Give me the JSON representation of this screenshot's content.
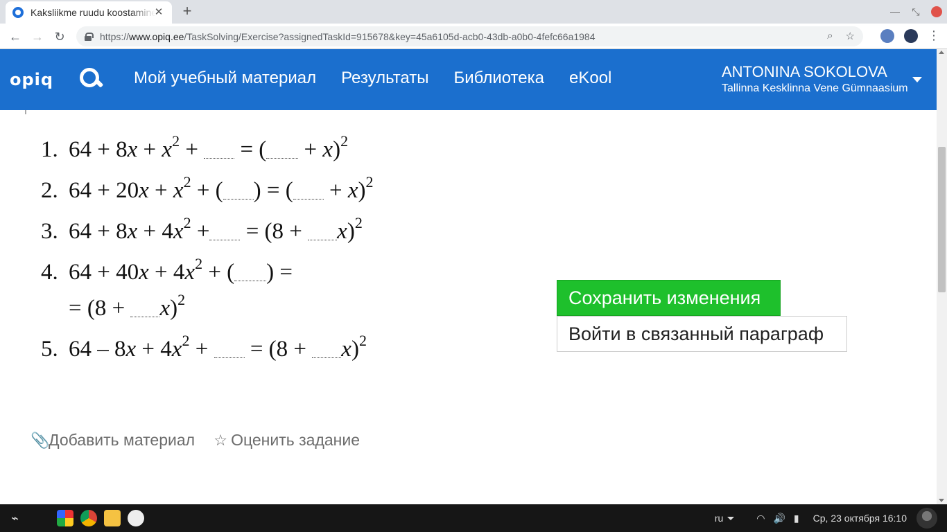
{
  "browser": {
    "tab_title": "Kaksliikme ruudu koostamine",
    "url_scheme": "https://",
    "url_host": "www.opiq.ee",
    "url_path": "/TaskSolving/Exercise?assignedTaskId=915678&key=45a6105d-acb0-43db-a0b0-4fefc66a1984"
  },
  "header": {
    "logo": "opiq",
    "nav": [
      "Мой учебный материал",
      "Результаты",
      "Библиотека",
      "eKool"
    ],
    "user_name": "ANTONINA SOKOLOVA",
    "user_school": "Tallinna Kesklinna Vene Gümnaasium"
  },
  "exercises": [
    {
      "num": "1."
    },
    {
      "num": "2."
    },
    {
      "num": "3."
    },
    {
      "num": "4."
    },
    {
      "num": "5."
    }
  ],
  "buttons": {
    "save": "Сохранить изменения",
    "enter_paragraph": "Войти в связанный параграф"
  },
  "footer_actions": {
    "add_material": "Добавить материал",
    "rate_task": "Оценить задание"
  },
  "taskbar": {
    "lang": "ru",
    "datetime": "Ср, 23 октября  16:10"
  }
}
